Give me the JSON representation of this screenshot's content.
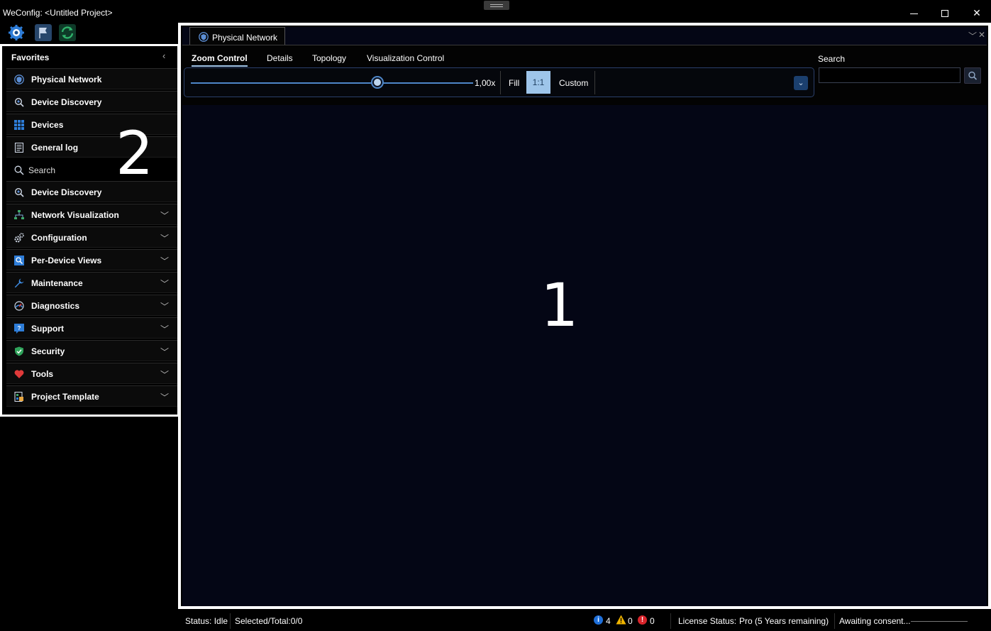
{
  "window": {
    "title": "WeConfig: <Untitled Project>",
    "minimize_icon": "minimize-icon",
    "maximize_icon": "maximize-icon",
    "close_label": "✕"
  },
  "quick_toolbar": {
    "items": [
      "settings-icon",
      "flag-icon",
      "refresh-icon"
    ]
  },
  "favorites": {
    "header": "Favorites",
    "collapse_label": "‹",
    "items": [
      {
        "label": "Physical Network",
        "icon": "physical-network-icon"
      },
      {
        "label": "Device Discovery",
        "icon": "device-discovery-icon"
      },
      {
        "label": "Devices",
        "icon": "devices-icon"
      },
      {
        "label": "General log",
        "icon": "log-icon"
      }
    ],
    "search_label": "Search",
    "nav_items": [
      {
        "label": "Device Discovery",
        "icon": "device-discovery-icon"
      },
      {
        "label": "Network Visualization",
        "icon": "network-visualization-icon"
      },
      {
        "label": "Configuration",
        "icon": "configuration-icon"
      },
      {
        "label": "Per-Device Views",
        "icon": "per-device-views-icon"
      },
      {
        "label": "Maintenance",
        "icon": "maintenance-icon"
      },
      {
        "label": "Diagnostics",
        "icon": "diagnostics-icon"
      },
      {
        "label": "Support",
        "icon": "support-icon"
      },
      {
        "label": "Security",
        "icon": "security-icon"
      },
      {
        "label": "Tools",
        "icon": "tools-icon"
      },
      {
        "label": "Project Template",
        "icon": "project-template-icon"
      }
    ],
    "chevron": "﹀",
    "annotation": "2"
  },
  "document": {
    "tab_label": "Physical Network",
    "tab_dropdown": "﹀",
    "tab_close": "✕",
    "ribbon_tabs": [
      "Zoom Control",
      "Details",
      "Topology",
      "Visualization Control"
    ],
    "active_ribbon_tab": "Zoom Control",
    "zoom": {
      "value_label": "1,00x",
      "slider_fraction": 0.66,
      "fill_label": "Fill",
      "one_to_one_label": "1:1",
      "custom_label": "Custom",
      "expand_label": "⌄"
    },
    "search_label": "Search",
    "search_value": "",
    "annotation": "1"
  },
  "status": {
    "status_text": "Status: Idle",
    "selected_total": "Selected/Total:0/0",
    "info_count": "4",
    "warning_count": "0",
    "error_count": "0",
    "license_label": "License Status:",
    "license_value": "Pro (5 Years remaining)",
    "consent_text": "Awaiting consent...",
    "colors": {
      "info": "#1e6fd9",
      "warning": "#f0b400",
      "error": "#d8242b"
    }
  },
  "colors": {
    "accent": "#4e86c8",
    "active_zoom_button": "#9ec5ea",
    "canvas_background": "#040615"
  }
}
